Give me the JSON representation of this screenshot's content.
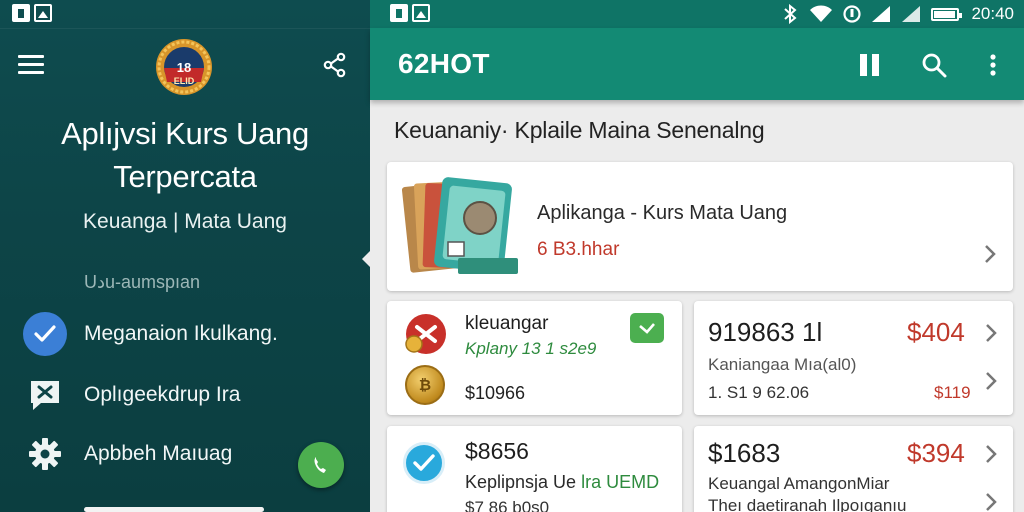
{
  "drawer": {
    "title_line1": "Aplıjvsi Kurs Uang",
    "title_line2": "Terpercata",
    "subtitle": "Keuanga | Mata Uang",
    "section_label": "Uدu-aumspıan",
    "items": [
      {
        "label": "Meganaion Ikulkang.",
        "icon": "check-circle-icon"
      },
      {
        "label": "Oplıgeekdrup Ira",
        "icon": "chat-bubble-icon"
      },
      {
        "label": "Apbbeh Maıuag",
        "icon": "gear-icon"
      }
    ],
    "badge_text": "18",
    "badge_sub": "ELID"
  },
  "statusbar": {
    "time": "20:40"
  },
  "toolbar": {
    "title": "62HOT"
  },
  "page_heading": "Keuananiy· Kplaile Maina Senenalng",
  "hero_card": {
    "title": "Aplikanga - Kurs Mata Uang",
    "subtitle": "6 B3.hhar"
  },
  "cards": {
    "a": {
      "name": "kleuangar",
      "green": "Kplany 13 1 s2e9",
      "amount": "$10966"
    },
    "b": {
      "big": "919863 1l",
      "price": "$404",
      "gray": "Kaniangaa Mıa(al0)",
      "num": "1. S1 9 62.06",
      "red_small": "$119"
    },
    "c": {
      "amount": "$8656",
      "text_plain": "Keplipnsja Ue ",
      "text_green": "lra UEMD",
      "footer": "$7 86 b0s0"
    },
    "d": {
      "big": "$1683",
      "price": "$394",
      "gray": "Keuangal AmangonMiar",
      "footer": "Theı daetiranah Ilpoıganıu"
    }
  },
  "colors": {
    "drawer_bg": "#0e4c4f",
    "toolbar": "#138a74",
    "statusbar": "#0f7466",
    "accent_red": "#c0392b",
    "accent_green": "#4caf50"
  }
}
